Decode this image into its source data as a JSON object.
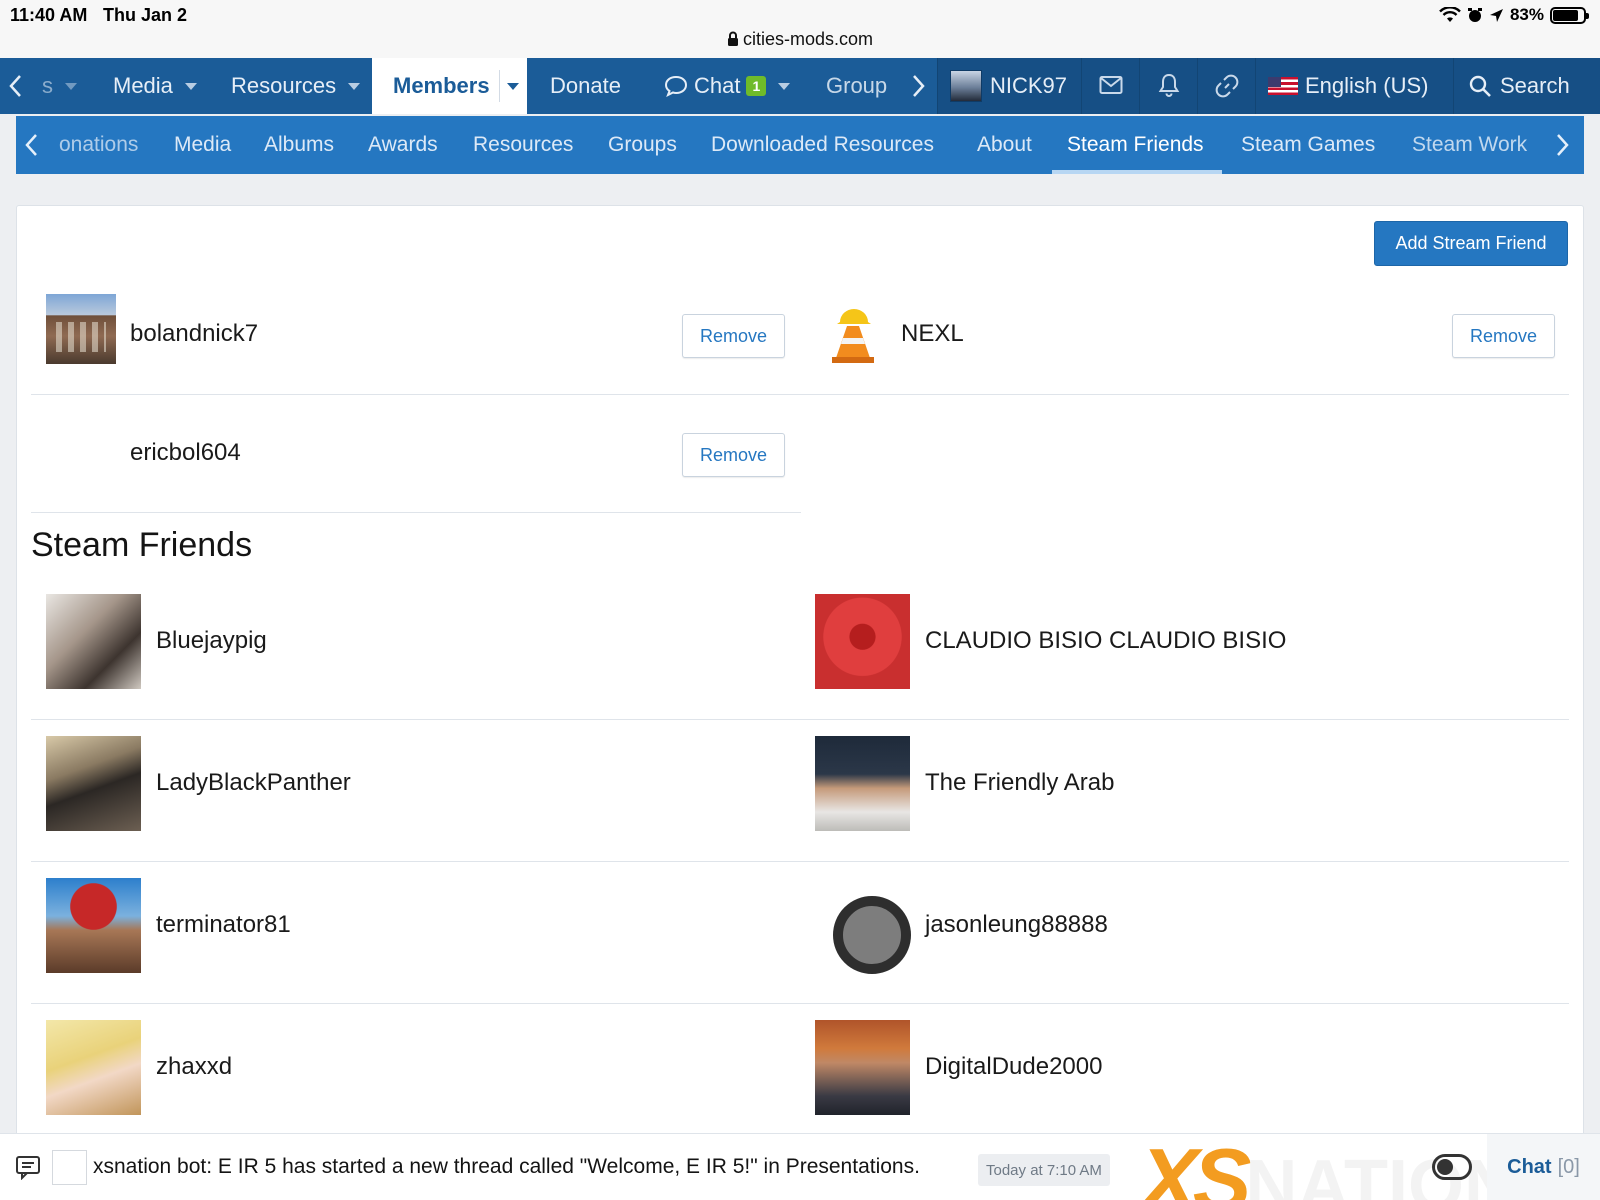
{
  "status_bar": {
    "time": "11:40 AM",
    "date": "Thu Jan 2",
    "battery": "83%",
    "url": "cities-mods.com"
  },
  "main_nav": {
    "prev_partial": "s",
    "items": [
      {
        "label": "Media"
      },
      {
        "label": "Resources"
      },
      {
        "label": "Members"
      },
      {
        "label": "Donate"
      },
      {
        "label": "Chat",
        "badge": "1"
      },
      {
        "label": "Group"
      }
    ],
    "user": "NICK97",
    "language": "English (US)",
    "search": "Search"
  },
  "sub_nav": {
    "items": [
      "onations",
      "Media",
      "Albums",
      "Awards",
      "Resources",
      "Groups",
      "Downloaded Resources",
      "About",
      "Steam Friends",
      "Steam Games",
      "Steam Work"
    ],
    "active": "Steam Friends"
  },
  "stream_friends": {
    "add_label": "Add Stream Friend",
    "remove_label": "Remove",
    "items": [
      {
        "name": "bolandnick7"
      },
      {
        "name": "NEXL"
      },
      {
        "name": "ericbol604"
      }
    ]
  },
  "steam_friends": {
    "title": "Steam Friends",
    "items": [
      {
        "name": "Bluejaypig"
      },
      {
        "name": "CLAUDIO BISIO CLAUDIO BISIO"
      },
      {
        "name": "LadyBlackPanther"
      },
      {
        "name": "The Friendly Arab"
      },
      {
        "name": "terminator81"
      },
      {
        "name": "jasonleung88888"
      },
      {
        "name": "zhaxxd"
      },
      {
        "name": "DigitalDude2000"
      }
    ]
  },
  "chat_bar": {
    "message": "xsnation bot: E IR 5 has started a new thread called \"Welcome, E IR 5!\" in Presentations.",
    "timestamp": "Today at 7:10 AM",
    "logo_xs": "XS",
    "logo_rest": "NATION",
    "chat_label": "Chat",
    "chat_count": "[0]"
  },
  "colors": {
    "nav": "#1b5c98",
    "subnav": "#2577c1",
    "accent": "#2577c1",
    "badge": "#6fbb2a",
    "logo": "#f39c20"
  }
}
